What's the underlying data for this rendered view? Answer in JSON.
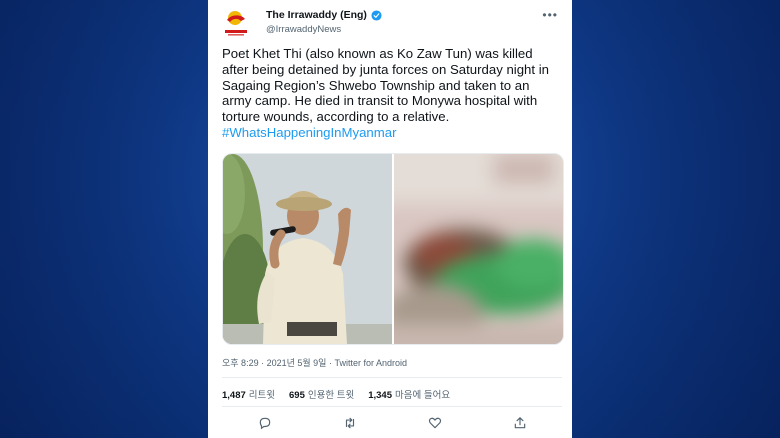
{
  "account": {
    "name": "The Irrawaddy (Eng)",
    "handle": "@IrrawaddyNews",
    "avatar_icon": "irrawaddy-logo",
    "verified_icon": "verified-badge-icon"
  },
  "tweet": {
    "text": "Poet Khet Thi (also known as Ko Zaw Tun) was killed after being detained by junta forces on Saturday night in Sagaing Region’s Shwebo Township and taken to an army camp. He died in transit to Monywa hospital with torture wounds, according to a relative.",
    "hashtag": "#WhatsHappeningInMyanmar"
  },
  "meta": {
    "timestamp": "오후 8:29 · 2021년 5월 9일 · Twitter for Android"
  },
  "stats": {
    "retweets_count": "1,487",
    "retweets_label": "리트윗",
    "quotes_count": "695",
    "quotes_label": "인용한 트윗",
    "likes_count": "1,345",
    "likes_label": "마음에 들어요"
  },
  "colors": {
    "background": "#0f3a88",
    "link": "#1d9bf0",
    "verified": "#1d9bf0",
    "text": "#0f1419",
    "secondary": "#536471"
  },
  "icons": {
    "more": "more-horizontal-icon",
    "reply": "reply-icon",
    "retweet": "retweet-icon",
    "like": "heart-icon",
    "share": "share-icon"
  }
}
